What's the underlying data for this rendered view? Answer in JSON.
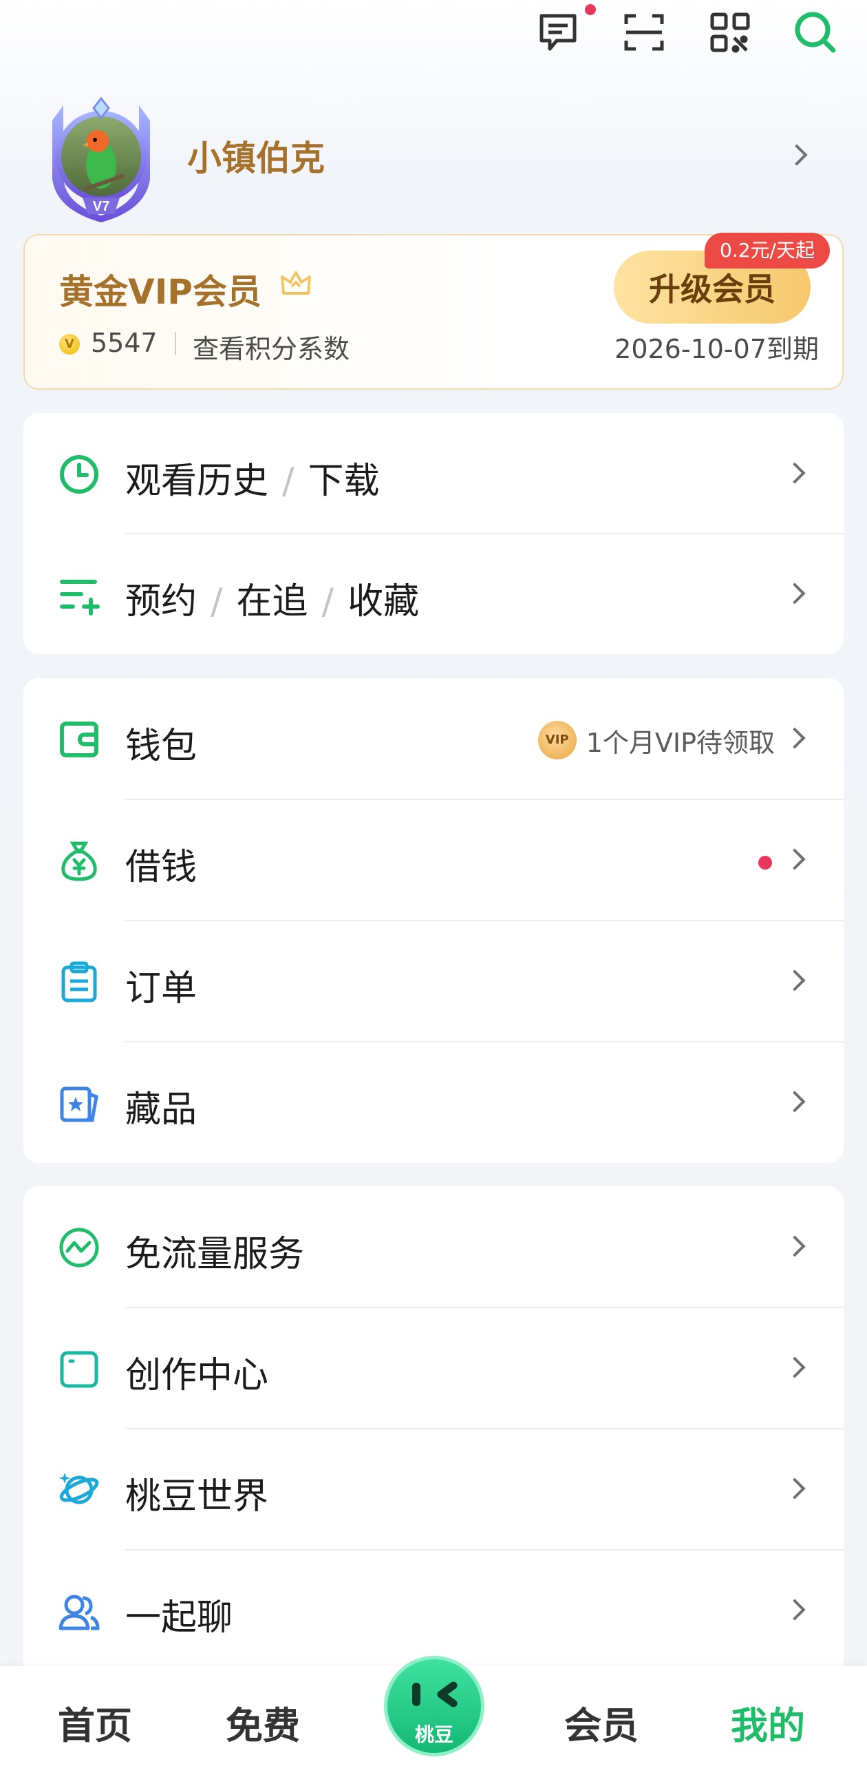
{
  "header": {
    "icons": [
      "message-icon",
      "scan-icon",
      "qrcode-icon",
      "search-icon"
    ]
  },
  "profile": {
    "username": "小镇伯克",
    "level_badge": "V7"
  },
  "vip": {
    "title": "黄金VIP会员",
    "points": "5547",
    "points_link": "查看积分系数",
    "upgrade_label": "升级会员",
    "price_badge": "0.2元/天起",
    "expire": "2026-10-07到期",
    "coin_glyph": "V"
  },
  "section1": {
    "history": {
      "part1": "观看历史",
      "part2": "下载"
    },
    "reserve": {
      "part1": "预约",
      "part2": "在追",
      "part3": "收藏"
    }
  },
  "section2": {
    "wallet": {
      "label": "钱包",
      "extra_badge": "VIP",
      "extra": "1个月VIP待领取"
    },
    "borrow": {
      "label": "借钱"
    },
    "orders": {
      "label": "订单"
    },
    "collection": {
      "label": "藏品"
    }
  },
  "section3": {
    "free_data": {
      "label": "免流量服务"
    },
    "creator": {
      "label": "创作中心"
    },
    "world": {
      "label": "桃豆世界"
    },
    "chat": {
      "label": "一起聊"
    }
  },
  "bottom_nav": {
    "home": "首页",
    "free": "免费",
    "center": "桃豆",
    "vip": "会员",
    "mine": "我的"
  },
  "colors": {
    "accent_green": "#1fbd6a",
    "gold_text": "#a6722b",
    "red_badge": "#ee4a45"
  }
}
